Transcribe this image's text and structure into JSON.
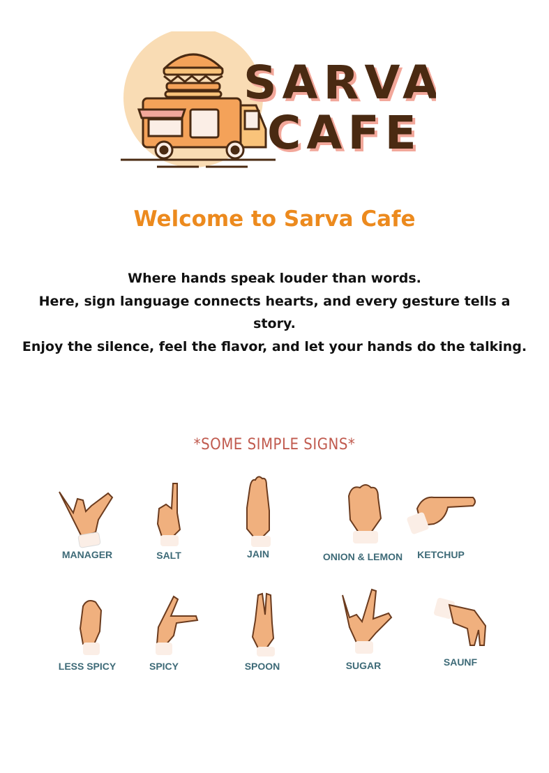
{
  "logo": {
    "line1": "SARVA",
    "line2": "CAFE",
    "icon": "burger-food-truck-icon",
    "colors": {
      "sun": "#f9dcb4",
      "text": "#4a2a12",
      "shadow": "#f2a79a",
      "truck": "#f4a259"
    }
  },
  "welcome": {
    "title": "Welcome to Sarva Cafe"
  },
  "intro": {
    "lines": [
      "Where hands speak louder than words.",
      "Here, sign language connects hearts, and every gesture tells a story.",
      "Enjoy the silence, feel the flavor, and let your hands do the talking."
    ]
  },
  "signs": {
    "title": "*SOME SIMPLE SIGNS*",
    "items": [
      {
        "label": "MANAGER",
        "icon": "shaka-hand-icon"
      },
      {
        "label": "SALT",
        "icon": "index-finger-up-hand-icon"
      },
      {
        "label": "JAIN",
        "icon": "three-fingers-up-hand-icon"
      },
      {
        "label": "ONION & LEMON",
        "icon": "fist-hand-icon"
      },
      {
        "label": "KETCHUP",
        "icon": "pointing-sideways-hand-icon"
      },
      {
        "label": "LESS SPICY",
        "icon": "fist-thumb-side-hand-icon"
      },
      {
        "label": "SPICY",
        "icon": "pointing-forward-hand-icon"
      },
      {
        "label": "SPOON",
        "icon": "two-fingers-up-hand-icon"
      },
      {
        "label": "SUGAR",
        "icon": "rock-sign-hand-icon"
      },
      {
        "label": "SAUNF",
        "icon": "pinch-down-hand-icon"
      }
    ]
  },
  "colors": {
    "accent": "#ec8a1e",
    "signs_title": "#c05a4e",
    "sign_label": "#3d6a77",
    "skin": "#f0b07e",
    "cuff": "#fbeee6"
  }
}
